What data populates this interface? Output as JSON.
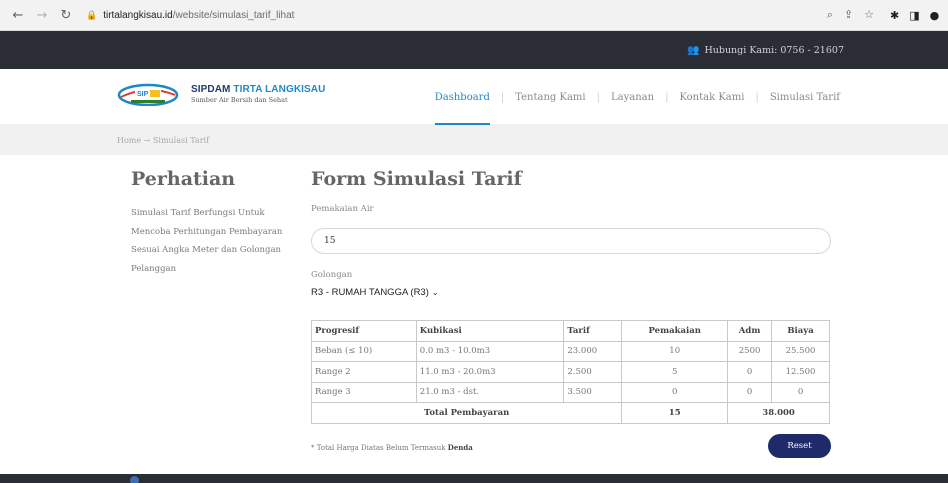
{
  "browser": {
    "url_host": "tirtalangkisau.id",
    "url_path": "/website/simulasi_tarif_lihat"
  },
  "topbar": {
    "contact_label": "Hubungi Kami: 0756 - 21607"
  },
  "header": {
    "brand_name_part1": "SIPDAM",
    "brand_name_part2": "TIRTA LANGKISAU",
    "tagline": "Sumber Air Bersih dan Sehat",
    "menu": [
      "Dashboard",
      "Tentang Kami",
      "Layanan",
      "Kontak Kami",
      "Simulasi Tarif"
    ],
    "active_menu": "Dashboard",
    "brand_color": "#1e88c7"
  },
  "breadcrumb": "Home → Simulasi Tarif",
  "sidebar": {
    "title": "Perhatian",
    "text": "Simulasi Tarif Berfungsi Untuk Mencoba Perhitungan Pembayaran Sesuai Angka Meter dan Golongan Pelanggan"
  },
  "form": {
    "title": "Form Simulasi Tarif",
    "usage_label": "Pemakaian Air",
    "usage_value": "15",
    "group_label": "Golongan",
    "group_selected": "R3 - RUMAH TANGGA (R3)",
    "table": {
      "headers": [
        "Progresif",
        "Kubikasi",
        "Tarif",
        "Pemakaian",
        "Adm",
        "Biaya"
      ],
      "rows": [
        [
          "Beban (≤ 10)",
          "0.0 m3 - 10.0m3",
          "23.000",
          "10",
          "2500",
          "25.500"
        ],
        [
          "Range 2",
          "11.0 m3 - 20.0m3",
          "2.500",
          "5",
          "0",
          "12.500"
        ],
        [
          "Range 3",
          "21.0 m3 - dst.",
          "3.500",
          "0",
          "0",
          "0"
        ]
      ],
      "total_label": "Total Pembayaran",
      "total_usage": "15",
      "total_cost": "38.000"
    },
    "note_prefix": "* Total Harga Diatas Belum Termasuk ",
    "note_bold": "Denda",
    "reset_label": "Reset",
    "button_color": "#1f2a6b"
  }
}
